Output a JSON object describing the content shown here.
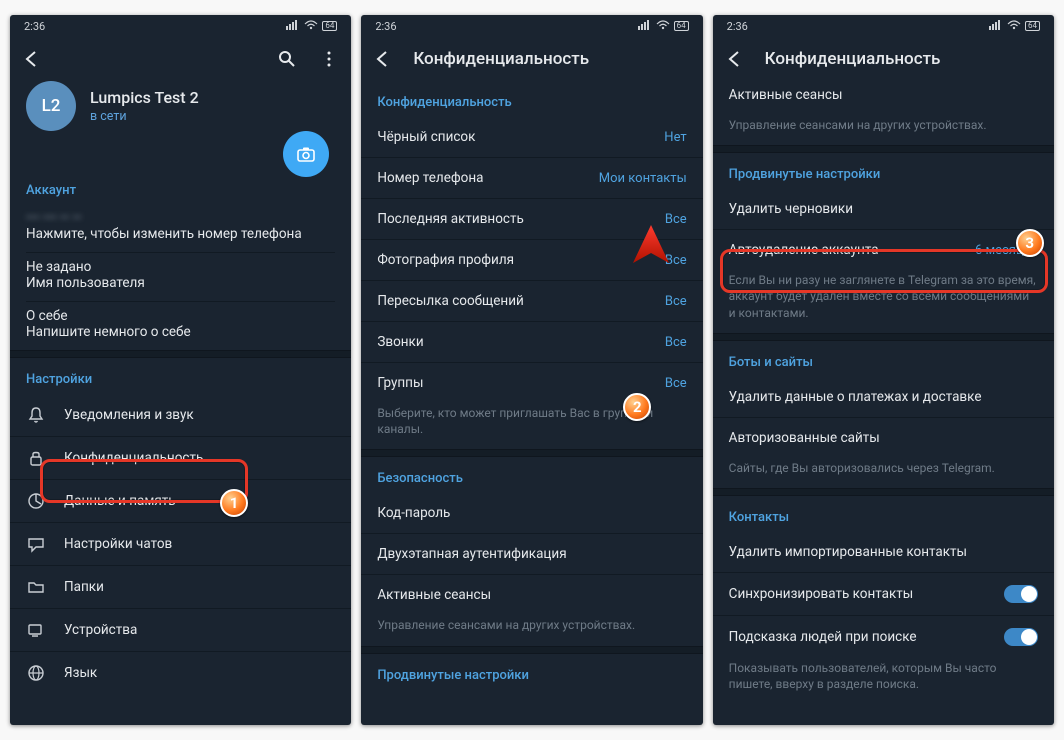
{
  "statusbar": {
    "time": "2:36",
    "battery": "64"
  },
  "phone1": {
    "avatar_initials": "L2",
    "profile_name": "Lumpics Test 2",
    "profile_status": "в сети",
    "sec_account": "Аккаунт",
    "phone_number": "••• ••• •• ••",
    "phone_hint": "Нажмите, чтобы изменить номер телефона",
    "username_value": "Не задано",
    "username_hint": "Имя пользователя",
    "bio_value": "О себе",
    "bio_hint": "Напишите немного о себе",
    "sec_settings": "Настройки",
    "items": [
      "Уведомления и звук",
      "Конфиденциальность",
      "Данные и память",
      "Настройки чатов",
      "Папки",
      "Устройства",
      "Язык"
    ]
  },
  "phone2": {
    "title": "Конфиденциальность",
    "sec_privacy": "Конфиденциальность",
    "blacklist_label": "Чёрный список",
    "blacklist_value": "Нет",
    "phone_label": "Номер телефона",
    "phone_value": "Мои контакты",
    "lastseen_label": "Последняя активность",
    "lastseen_value": "Все",
    "photo_label": "Фотография профиля",
    "photo_value": "Все",
    "forward_label": "Пересылка сообщений",
    "forward_value": "Все",
    "calls_label": "Звонки",
    "calls_value": "Все",
    "groups_label": "Группы",
    "groups_value": "Все",
    "groups_hint": "Выберите, кто может приглашать Вас в группы и каналы.",
    "sec_security": "Безопасность",
    "passcode": "Код-пароль",
    "twostep": "Двухэтапная аутентификация",
    "sessions": "Активные сеансы",
    "sessions_hint": "Управление сеансами на других устройствах.",
    "sec_advanced": "Продвинутые настройки"
  },
  "phone3": {
    "title": "Конфиденциальность",
    "sessions": "Активные сеансы",
    "sessions_hint": "Управление сеансами на других устройствах.",
    "sec_advanced": "Продвинутые настройки",
    "drafts": "Удалить черновики",
    "autodel_label": "Автоудаление аккаунта",
    "autodel_value": "6 месяцев",
    "autodel_hint": "Если Вы ни разу не заглянете в Telegram за это время, аккаунт будет удалён вместе со всеми сообщениями и контактами.",
    "sec_bots": "Боты и сайты",
    "payments": "Удалить данные о платежах и доставке",
    "auth_sites": "Авторизованные сайты",
    "auth_hint": "Сайты, где Вы авторизовались через Telegram.",
    "sec_contacts": "Контакты",
    "del_contacts": "Удалить импортированные контакты",
    "sync_contacts": "Синхронизировать контакты",
    "suggest": "Подсказка людей при поиске",
    "suggest_hint": "Показывать пользователей, которым Вы часто пишете, вверху в разделе поиска."
  },
  "badges": {
    "b1": "1",
    "b2": "2",
    "b3": "3"
  }
}
